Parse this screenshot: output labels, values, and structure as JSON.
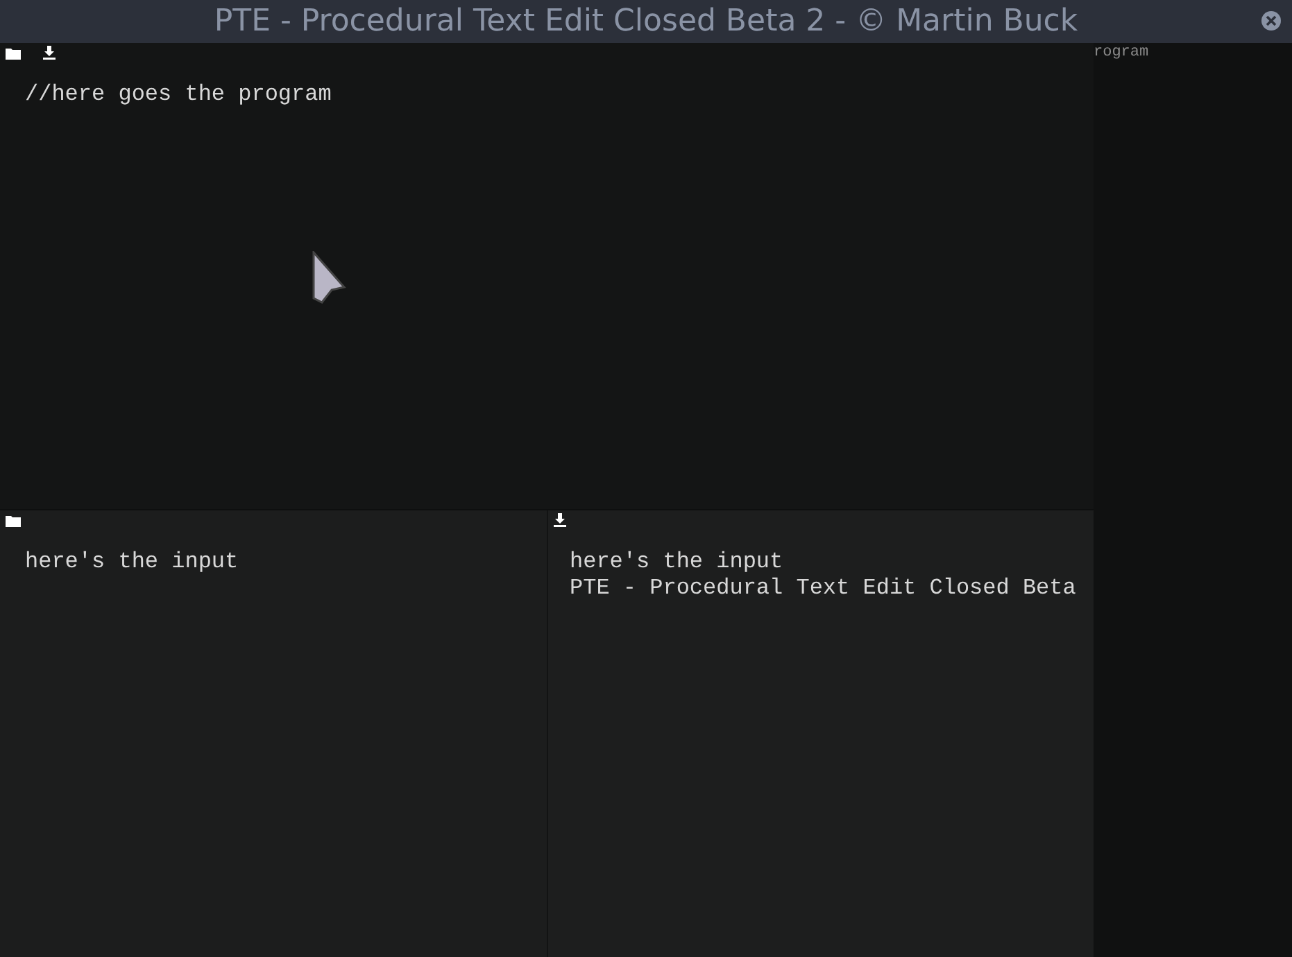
{
  "window": {
    "title": "PTE - Procedural Text Edit Closed Beta 2 - © Martin Buck"
  },
  "program_editor": {
    "value": "//here goes the program"
  },
  "input_editor": {
    "value": "here's the input"
  },
  "output_view": {
    "lines": [
      "here's the input",
      "PTE - Procedural Text Edit Closed Beta"
    ]
  },
  "side_panel": {
    "label": "rogram"
  }
}
